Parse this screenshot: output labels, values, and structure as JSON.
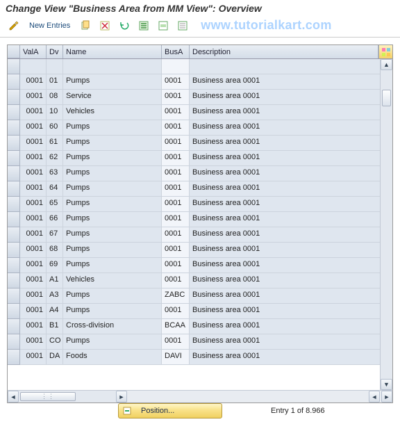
{
  "title": "Change View \"Business Area from MM View\": Overview",
  "toolbar": {
    "new_entries": "New Entries"
  },
  "watermark": "www.tutorialkart.com",
  "columns": {
    "vala": "ValA",
    "dv": "Dv",
    "name": "Name",
    "busa": "BusA",
    "desc": "Description"
  },
  "rows": [
    {
      "vala": "",
      "dv": "",
      "name": "",
      "busa": "",
      "desc": ""
    },
    {
      "vala": "0001",
      "dv": "01",
      "name": "Pumps",
      "busa": "0001",
      "desc": "Business area 0001"
    },
    {
      "vala": "0001",
      "dv": "08",
      "name": "Service",
      "busa": "0001",
      "desc": "Business area 0001"
    },
    {
      "vala": "0001",
      "dv": "10",
      "name": "Vehicles",
      "busa": "0001",
      "desc": "Business area 0001"
    },
    {
      "vala": "0001",
      "dv": "60",
      "name": "Pumps",
      "busa": "0001",
      "desc": "Business area 0001"
    },
    {
      "vala": "0001",
      "dv": "61",
      "name": "Pumps",
      "busa": "0001",
      "desc": "Business area 0001"
    },
    {
      "vala": "0001",
      "dv": "62",
      "name": "Pumps",
      "busa": "0001",
      "desc": "Business area 0001"
    },
    {
      "vala": "0001",
      "dv": "63",
      "name": "Pumps",
      "busa": "0001",
      "desc": "Business area 0001"
    },
    {
      "vala": "0001",
      "dv": "64",
      "name": "Pumps",
      "busa": "0001",
      "desc": "Business area 0001"
    },
    {
      "vala": "0001",
      "dv": "65",
      "name": "Pumps",
      "busa": "0001",
      "desc": "Business area 0001"
    },
    {
      "vala": "0001",
      "dv": "66",
      "name": "Pumps",
      "busa": "0001",
      "desc": "Business area 0001"
    },
    {
      "vala": "0001",
      "dv": "67",
      "name": "Pumps",
      "busa": "0001",
      "desc": "Business area 0001"
    },
    {
      "vala": "0001",
      "dv": "68",
      "name": "Pumps",
      "busa": "0001",
      "desc": "Business area 0001"
    },
    {
      "vala": "0001",
      "dv": "69",
      "name": "Pumps",
      "busa": "0001",
      "desc": "Business area 0001"
    },
    {
      "vala": "0001",
      "dv": "A1",
      "name": "Vehicles",
      "busa": "0001",
      "desc": "Business area 0001"
    },
    {
      "vala": "0001",
      "dv": "A3",
      "name": "Pumps",
      "busa": "ZABC",
      "desc": "Business area 0001"
    },
    {
      "vala": "0001",
      "dv": "A4",
      "name": "Pumps",
      "busa": "0001",
      "desc": "Business area 0001"
    },
    {
      "vala": "0001",
      "dv": "B1",
      "name": "Cross-division",
      "busa": "BCAA",
      "desc": "Business area 0001"
    },
    {
      "vala": "0001",
      "dv": "CO",
      "name": "Pumps",
      "busa": "0001",
      "desc": "Business area 0001"
    },
    {
      "vala": "0001",
      "dv": "DA",
      "name": "Foods",
      "busa": "DAVI",
      "desc": "Business area 0001"
    }
  ],
  "footer": {
    "position_label": "Position...",
    "entry_text": "Entry 1 of 8.966"
  }
}
